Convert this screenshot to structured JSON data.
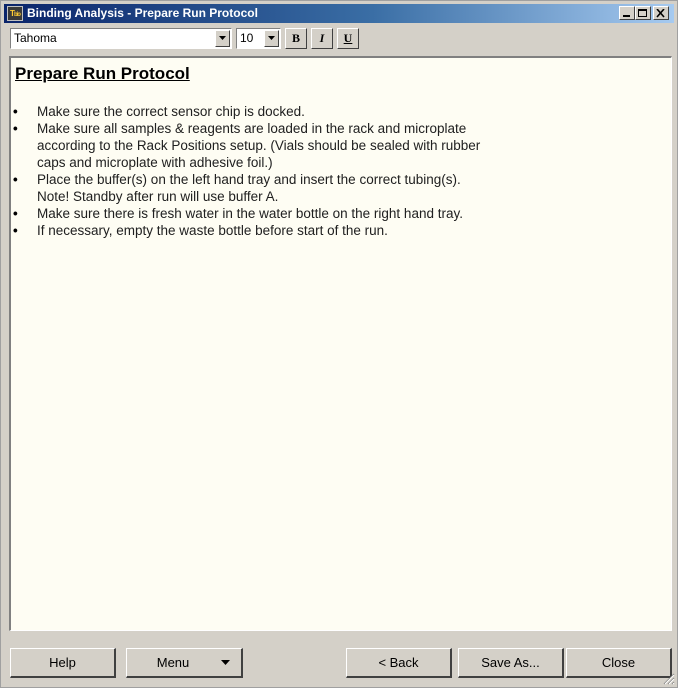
{
  "window": {
    "title": "Binding Analysis - Prepare Run Protocol",
    "app_icon_text": "Tᵦᵢₒ"
  },
  "toolbar": {
    "font_name": "Tahoma",
    "font_size": "10",
    "bold_label": "B",
    "italic_label": "I",
    "underline_label": "U"
  },
  "document": {
    "heading": "Prepare Run Protocol",
    "bullet_char": "•",
    "items": [
      {
        "lines": [
          "Make sure the correct sensor chip is docked."
        ]
      },
      {
        "lines": [
          "Make sure all samples & reagents are loaded in the rack and microplate",
          "according to the Rack Positions setup. (Vials should be sealed with rubber",
          "caps and microplate with adhesive foil.)"
        ]
      },
      {
        "lines": [
          "Place the buffer(s) on the left hand tray and insert the correct tubing(s).",
          "Note! Standby after run will use buffer A."
        ]
      },
      {
        "lines": [
          "Make sure there is fresh water in the water bottle on the right hand tray."
        ]
      },
      {
        "lines": [
          "If necessary, empty the waste bottle before start of the run."
        ]
      }
    ]
  },
  "buttons": {
    "help": "Help",
    "menu": "Menu",
    "back": "< Back",
    "save_as": "Save As...",
    "close": "Close"
  }
}
